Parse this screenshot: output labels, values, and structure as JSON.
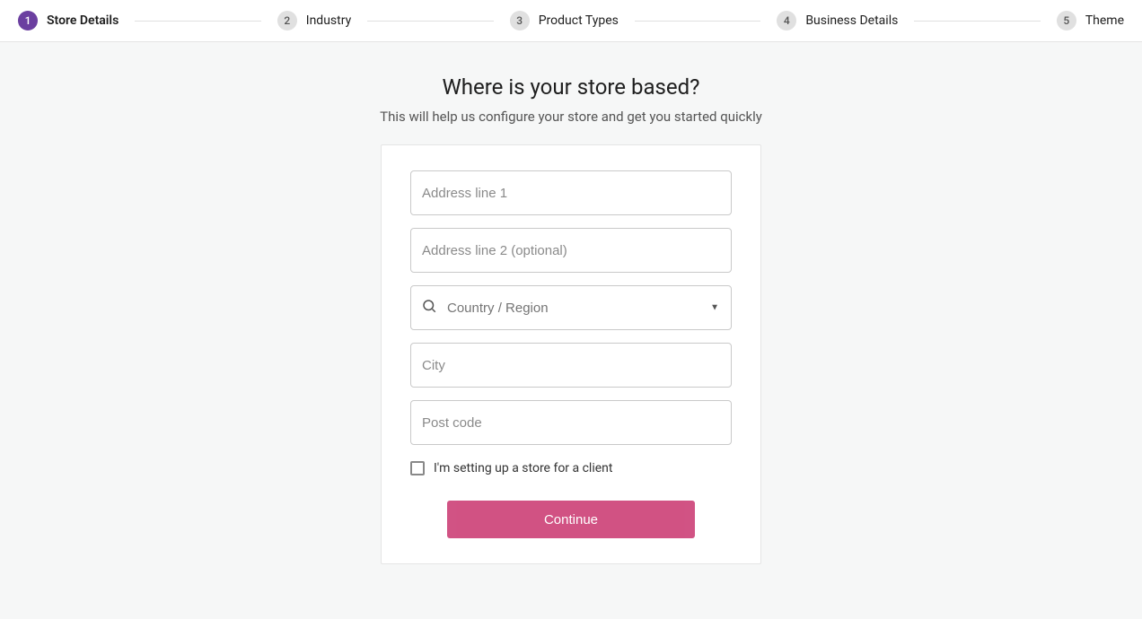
{
  "stepper": {
    "steps": [
      {
        "num": "1",
        "label": "Store Details",
        "active": true
      },
      {
        "num": "2",
        "label": "Industry",
        "active": false
      },
      {
        "num": "3",
        "label": "Product Types",
        "active": false
      },
      {
        "num": "4",
        "label": "Business Details",
        "active": false
      },
      {
        "num": "5",
        "label": "Theme",
        "active": false
      }
    ]
  },
  "heading": {
    "title": "Where is your store based?",
    "subtitle": "This will help us configure your store and get you started quickly"
  },
  "form": {
    "address1_placeholder": "Address line 1",
    "address2_placeholder": "Address line 2 (optional)",
    "country_placeholder": "Country / Region",
    "city_placeholder": "City",
    "postcode_placeholder": "Post code",
    "client_checkbox_label": "I'm setting up a store for a client",
    "continue_label": "Continue"
  }
}
